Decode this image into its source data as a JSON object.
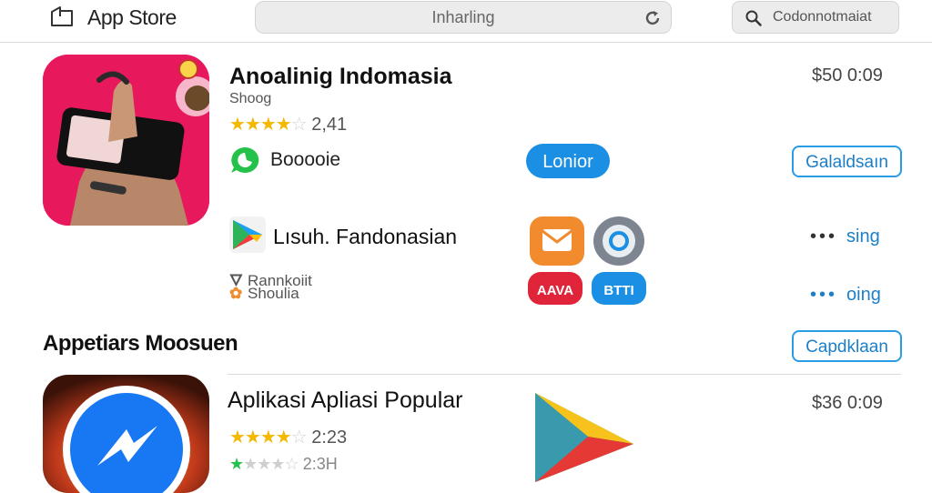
{
  "header": {
    "store_title": "App Store",
    "address_text": "Inharling",
    "search_text": "Codonnotmaiat"
  },
  "featured": {
    "title": "Anoalinig Indomasia",
    "subtitle": "Shoog",
    "rating_value": "2,41",
    "price": "$50 0:09",
    "developer": "Booooie",
    "action_label": "Lonior",
    "secondary_label": "Galaldsaın"
  },
  "list": {
    "title": "Lısuh. Fandonasian",
    "rows": [
      {
        "label": "Rannkoiit",
        "more_label": "sing"
      },
      {
        "label": "Shoulia",
        "more_label": "oing"
      }
    ],
    "tiles": [
      {
        "label": "",
        "color": "#f28a2e"
      },
      {
        "label": "",
        "color": "#7d8590"
      },
      {
        "label": "AAVA",
        "color": "#e0243a"
      },
      {
        "label": "BTTI",
        "color": "#1a8fe3"
      }
    ]
  },
  "section": {
    "title": "Appetiars Moosuen",
    "button_label": "Capdklaan"
  },
  "app2": {
    "title": "Aplikasi Apliasi Popular",
    "rating_value": "2:23",
    "rating_value_2": "2:3H",
    "price": "$36 0:09"
  },
  "colors": {
    "accent": "#1a8fe3",
    "star": "#f5b800",
    "thumb_bg": "#e8185d"
  }
}
